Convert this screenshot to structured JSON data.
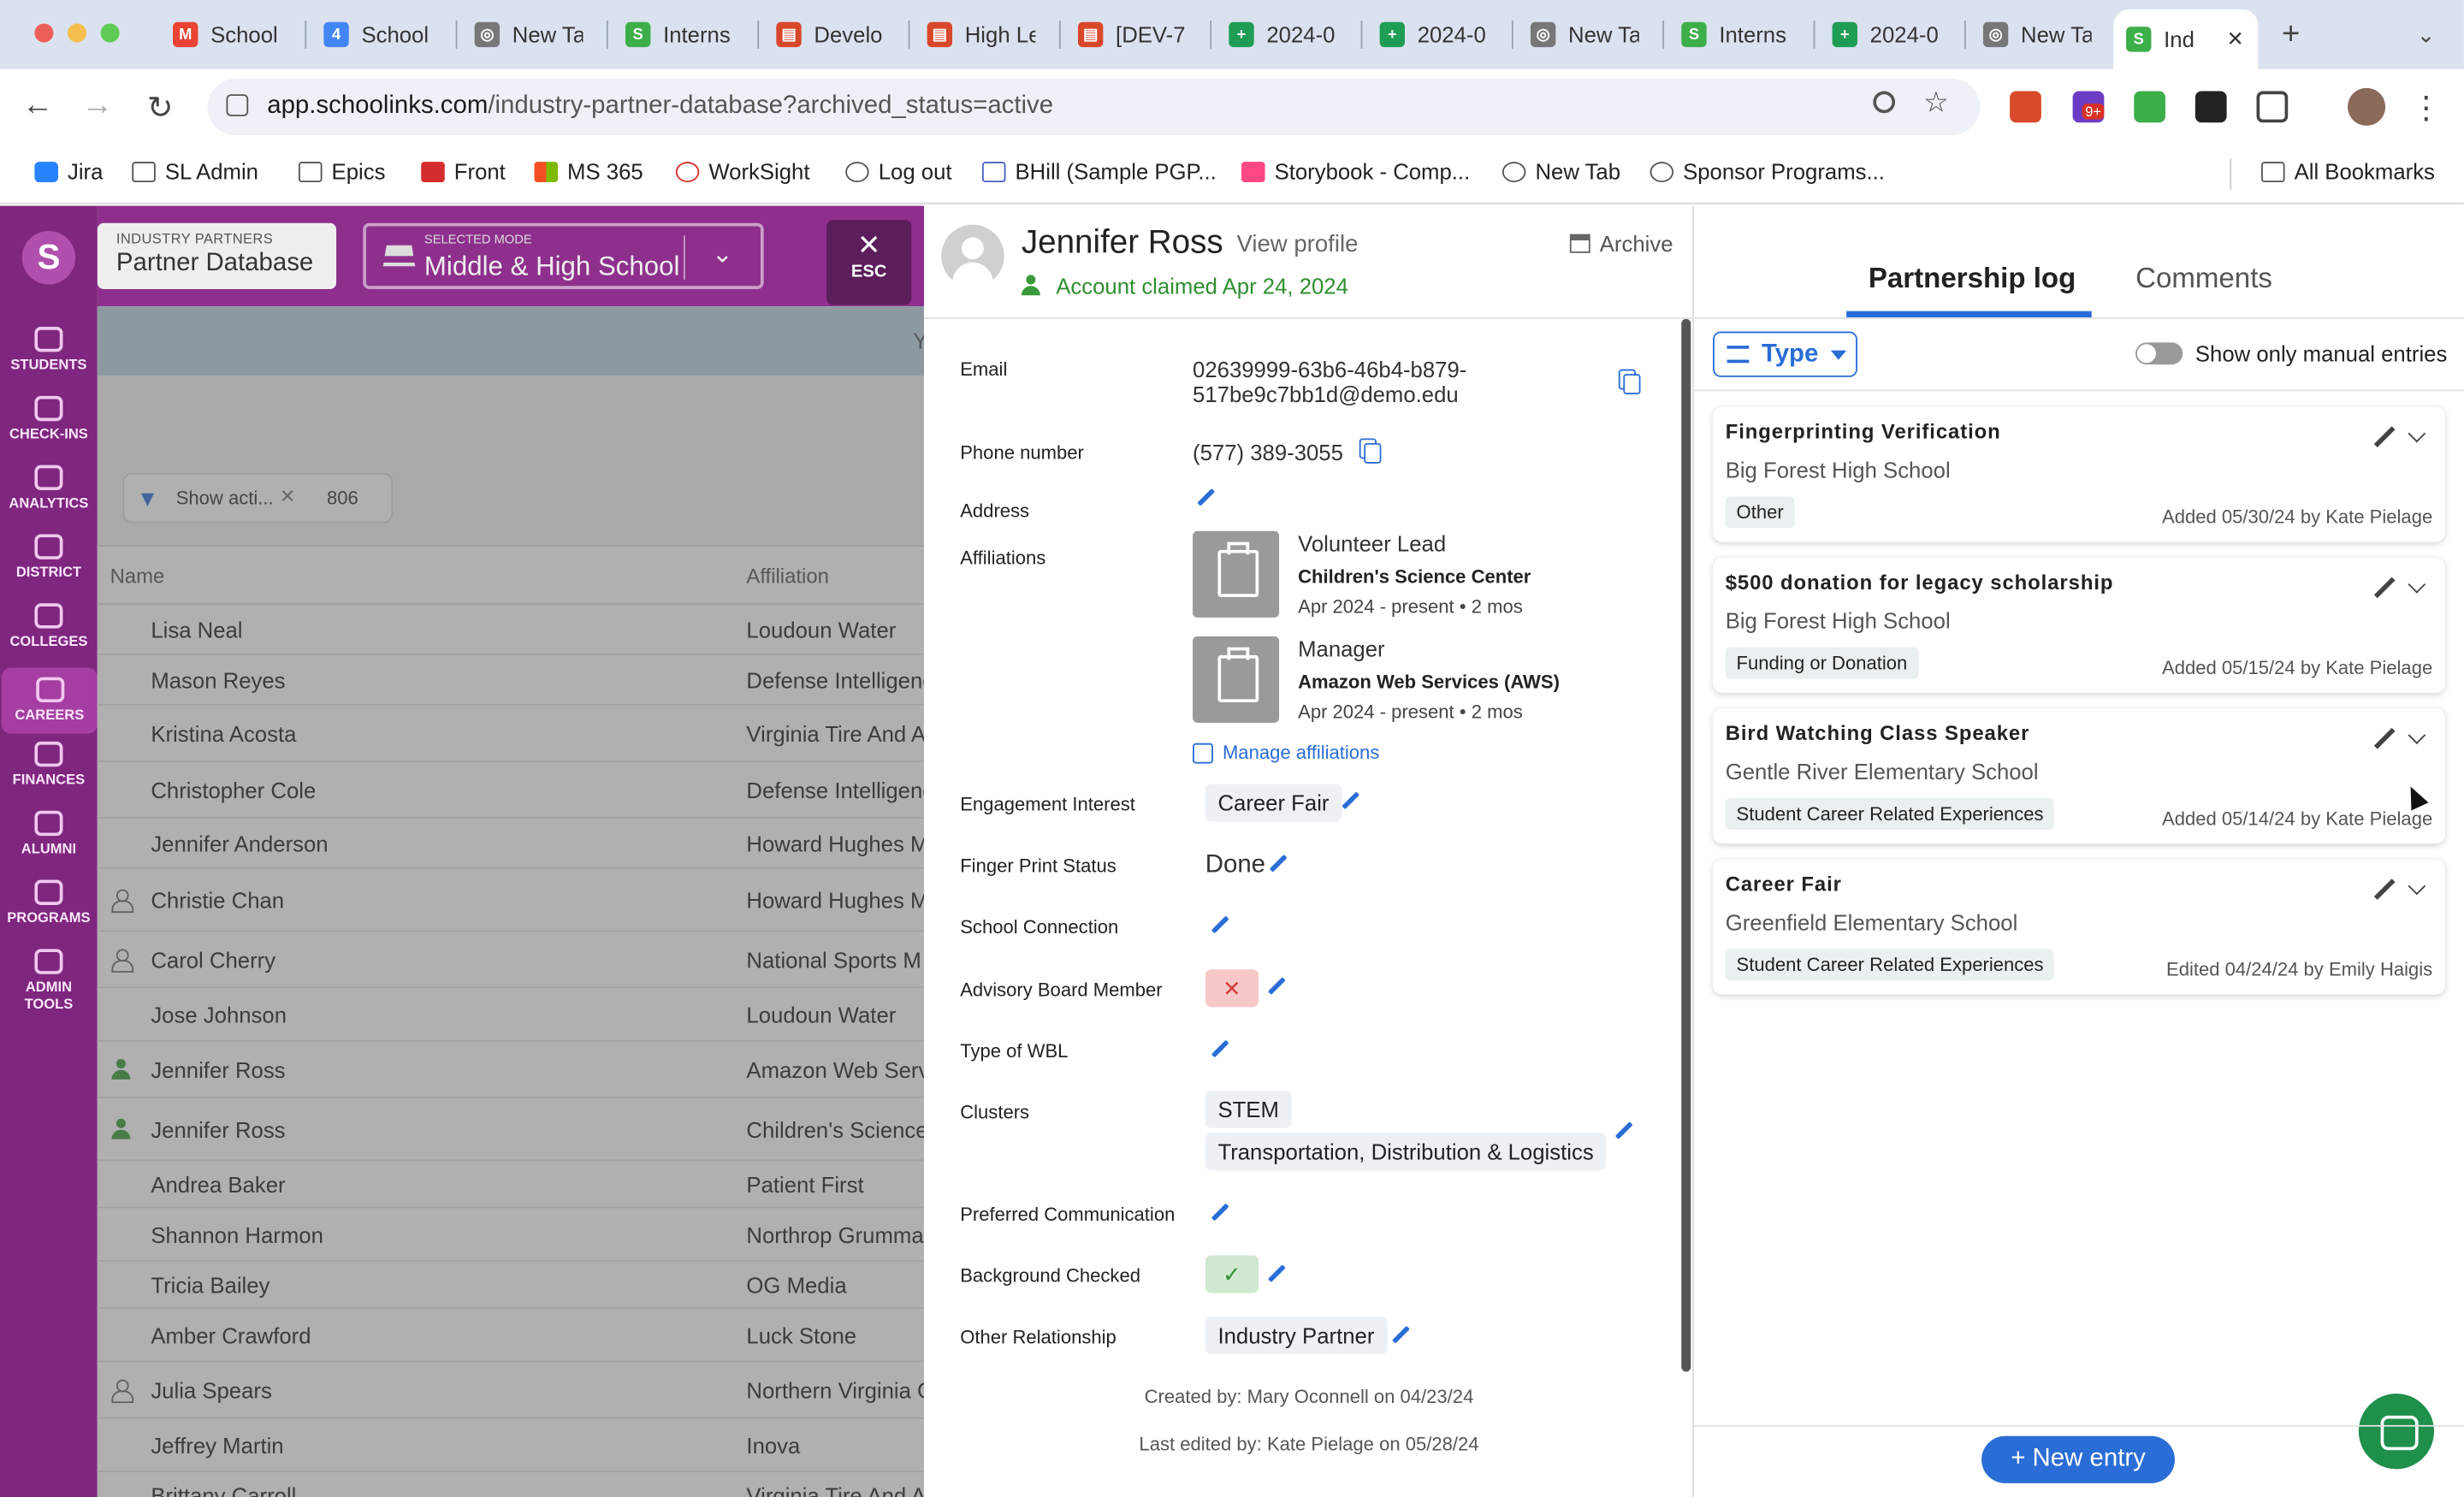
{
  "browser": {
    "tabs": [
      {
        "label": "School",
        "color": "#ea4335",
        "glyph": "M"
      },
      {
        "label": "School",
        "color": "#4285f4",
        "glyph": "4"
      },
      {
        "label": "New Ta",
        "color": "#777777",
        "glyph": "◎"
      },
      {
        "label": "Interns",
        "color": "#3cae4a",
        "glyph": "S"
      },
      {
        "label": "Develo",
        "color": "#d9472b",
        "glyph": "▤"
      },
      {
        "label": "High Le",
        "color": "#d9472b",
        "glyph": "▤"
      },
      {
        "label": "[DEV-7",
        "color": "#d9472b",
        "glyph": "▤"
      },
      {
        "label": "2024-0",
        "color": "#1f9d55",
        "glyph": "+"
      },
      {
        "label": "2024-0",
        "color": "#1f9d55",
        "glyph": "+"
      },
      {
        "label": "New Ta",
        "color": "#777777",
        "glyph": "◎"
      },
      {
        "label": "Interns",
        "color": "#3cae4a",
        "glyph": "S"
      },
      {
        "label": "2024-0",
        "color": "#1f9d55",
        "glyph": "+"
      },
      {
        "label": "New Ta",
        "color": "#777777",
        "glyph": "◎"
      },
      {
        "label": "Ind",
        "color": "#3cae4a",
        "glyph": "S"
      }
    ],
    "url_host": "app.schoolinks.com",
    "url_path": "/industry-partner-database?archived_status=active",
    "ext_badge": "9+",
    "bookmarks": [
      "Jira",
      "SL Admin",
      "Epics",
      "Front",
      "MS 365",
      "WorkSight",
      "Log out",
      "BHill (Sample PGP...",
      "Storybook - Comp...",
      "New Tab",
      "Sponsor Programs..."
    ],
    "all_bookmarks": "All Bookmarks"
  },
  "nav": {
    "logo": "S",
    "items": [
      "STUDENTS",
      "CHECK-INS",
      "ANALYTICS",
      "DISTRICT",
      "COLLEGES",
      "CAREERS",
      "FINANCES",
      "ALUMNI",
      "PROGRAMS",
      "ADMIN TOOLS"
    ],
    "active": "CAREERS"
  },
  "header": {
    "section_caption": "INDUSTRY PARTNERS",
    "section_title": "Partner Database",
    "mode_caption": "SELECTED MODE",
    "mode_value": "Middle & High School",
    "esc_label": "ESC"
  },
  "table": {
    "banner_text": "Y",
    "filter_label": "Show acti...",
    "count": "806",
    "col_name": "Name",
    "col_affiliation": "Affiliation",
    "rows": [
      {
        "name": "Lisa Neal",
        "affiliation": "Loudoun Water",
        "person": ""
      },
      {
        "name": "Mason Reyes",
        "affiliation": "Defense Intelligenc",
        "person": ""
      },
      {
        "name": "Kristina Acosta",
        "affiliation": "Virginia Tire And A",
        "person": ""
      },
      {
        "name": "Christopher Cole",
        "affiliation": "Defense Intelligenc",
        "person": ""
      },
      {
        "name": "Jennifer Anderson",
        "affiliation": "Howard Hughes M",
        "person": ""
      },
      {
        "name": "Christie Chan",
        "affiliation": "Howard Hughes M",
        "person": "gray"
      },
      {
        "name": "Carol Cherry",
        "affiliation": "National Sports M",
        "person": "gray"
      },
      {
        "name": "Jose Johnson",
        "affiliation": "Loudoun Water",
        "person": ""
      },
      {
        "name": "Jennifer Ross",
        "affiliation": "Amazon Web Serv",
        "person": "green"
      },
      {
        "name": "Jennifer Ross",
        "affiliation": "Children's Science",
        "person": "green"
      },
      {
        "name": "Andrea Baker",
        "affiliation": "Patient First",
        "person": ""
      },
      {
        "name": "Shannon Harmon",
        "affiliation": "Northrop Grumma",
        "person": ""
      },
      {
        "name": "Tricia Bailey",
        "affiliation": "OG Media",
        "person": ""
      },
      {
        "name": "Amber Crawford",
        "affiliation": "Luck Stone",
        "person": ""
      },
      {
        "name": "Julia Spears",
        "affiliation": "Northern Virginia C",
        "person": "gray"
      },
      {
        "name": "Jeffrey Martin",
        "affiliation": "Inova",
        "person": ""
      },
      {
        "name": "Brittany Carroll",
        "affiliation": "Virginia Tire And A",
        "person": ""
      }
    ]
  },
  "profile": {
    "name": "Jennifer Ross",
    "view_profile": "View profile",
    "claimed": "Account claimed Apr 24, 2024",
    "archive": "Archive",
    "labels": {
      "email": "Email",
      "phone": "Phone number",
      "address": "Address",
      "affiliations": "Affiliations",
      "engagement": "Engagement Interest",
      "fingerprint": "Finger Print Status",
      "school_connection": "School Connection",
      "advisory": "Advisory Board Member",
      "wbl": "Type of WBL",
      "clusters": "Clusters",
      "pref_comm": "Preferred Communication",
      "background": "Background Checked",
      "other_rel": "Other Relationship"
    },
    "email_line1": "02639999-63b6-46b4-b879-",
    "email_line2": "517be9c7bb1d@demo.edu",
    "phone": "(577) 389-3055",
    "affiliations": [
      {
        "role": "Volunteer Lead",
        "org": "Children's Science Center",
        "dates": "Apr 2024 - present",
        "dot": "•",
        "duration": "2 mos"
      },
      {
        "role": "Manager",
        "org": "Amazon Web Services (AWS)",
        "dates": "Apr 2024 - present",
        "dot": "•",
        "duration": "2 mos"
      }
    ],
    "manage_affiliations": "Manage affiliations",
    "engagement": "Career Fair",
    "fingerprint": "Done",
    "advisory_icon": "✕",
    "clusters": [
      "STEM",
      "Transportation, Distribution & Logistics"
    ],
    "background_icon": "✓",
    "other_rel": "Industry Partner",
    "created_by_label": "Created by:",
    "created_by": "Mary Oconnell on 04/23/24",
    "edited_by_label": "Last edited by:",
    "edited_by": "Kate Pielage on 05/28/24"
  },
  "log": {
    "tab_log": "Partnership log",
    "tab_comments": "Comments",
    "type_button": "Type",
    "toggle_label": "Show only manual entries",
    "entries": [
      {
        "title": "Fingerprinting Verification",
        "school": "Big Forest High School",
        "tag": "Other",
        "meta": "Added 05/30/24 by Kate Pielage"
      },
      {
        "title": "$500 donation for legacy scholarship",
        "school": "Big Forest High School",
        "tag": "Funding or Donation",
        "meta": "Added 05/15/24 by Kate Pielage"
      },
      {
        "title": "Bird Watching Class Speaker",
        "school": "Gentle River Elementary School",
        "tag": "Student Career Related Experiences",
        "meta": "Added 05/14/24 by Kate Pielage"
      },
      {
        "title": "Career Fair",
        "school": "Greenfield Elementary School",
        "tag": "Student Career Related Experiences",
        "meta": "Edited 04/24/24 by Emily Haigis"
      }
    ],
    "new_entry": "+ New entry"
  }
}
